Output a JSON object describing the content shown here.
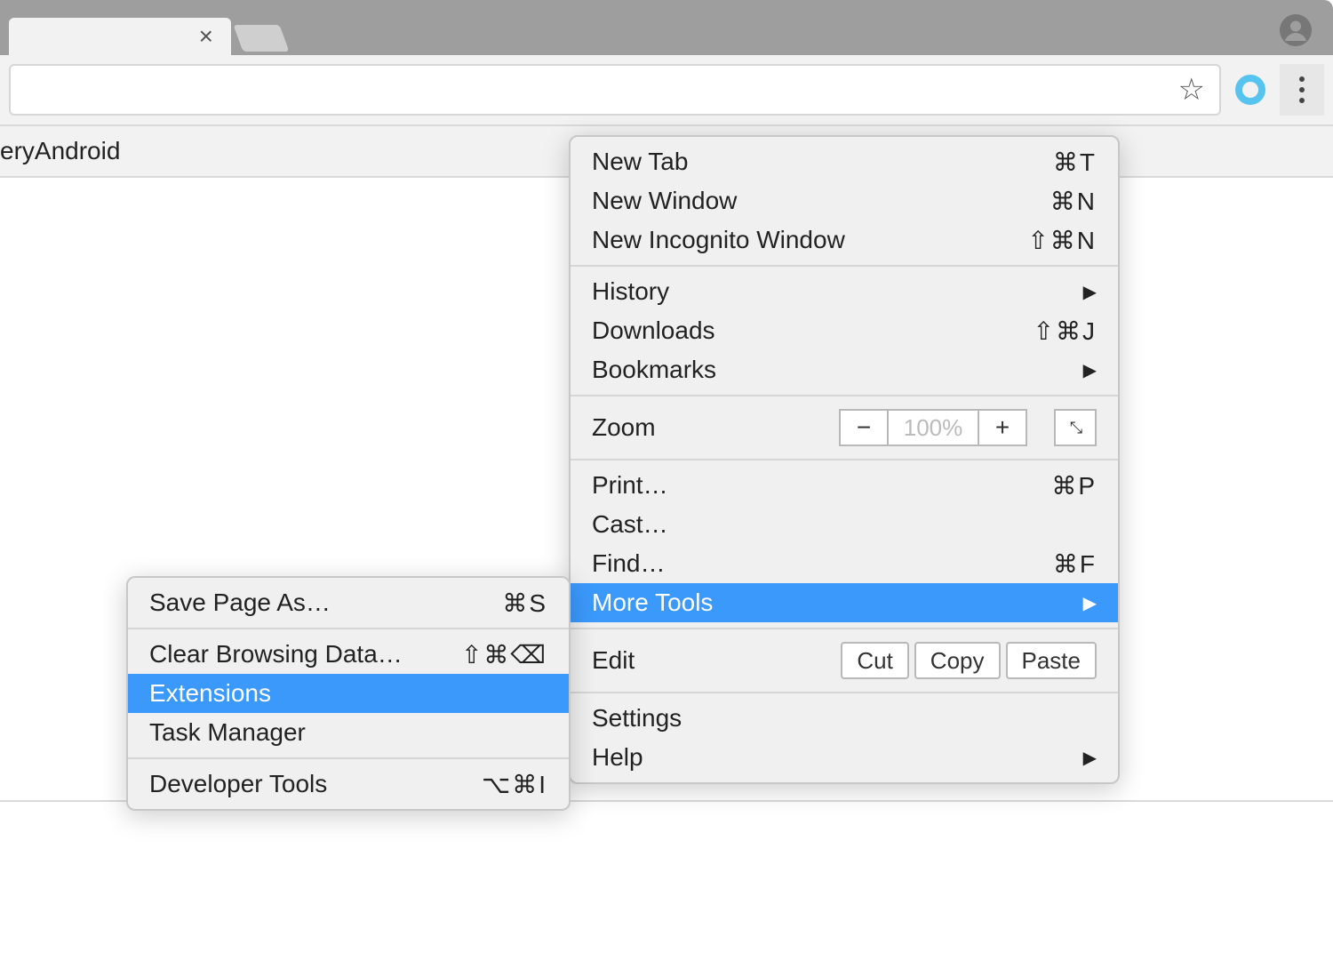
{
  "infobar_text": "eryAndroid",
  "main_menu": {
    "new_tab": {
      "label": "New Tab",
      "shortcut": "⌘T"
    },
    "new_win": {
      "label": "New Window",
      "shortcut": "⌘N"
    },
    "new_incog": {
      "label": "New Incognito Window",
      "shortcut": "⇧⌘N"
    },
    "history": {
      "label": "History"
    },
    "downloads": {
      "label": "Downloads",
      "shortcut": "⇧⌘J"
    },
    "bookmarks": {
      "label": "Bookmarks"
    },
    "zoom": {
      "label": "Zoom",
      "value": "100%"
    },
    "print": {
      "label": "Print…",
      "shortcut": "⌘P"
    },
    "cast": {
      "label": "Cast…"
    },
    "find": {
      "label": "Find…",
      "shortcut": "⌘F"
    },
    "more_tools": {
      "label": "More Tools"
    },
    "edit": {
      "label": "Edit",
      "cut": "Cut",
      "copy": "Copy",
      "paste": "Paste"
    },
    "settings": {
      "label": "Settings"
    },
    "help": {
      "label": "Help"
    }
  },
  "sub_menu": {
    "save_as": {
      "label": "Save Page As…",
      "shortcut": "⌘S"
    },
    "clear": {
      "label": "Clear Browsing Data…",
      "shortcut": "⇧⌘⌫"
    },
    "extensions": {
      "label": "Extensions"
    },
    "task_mgr": {
      "label": "Task Manager"
    },
    "dev_tools": {
      "label": "Developer Tools",
      "shortcut": "⌥⌘I"
    }
  }
}
